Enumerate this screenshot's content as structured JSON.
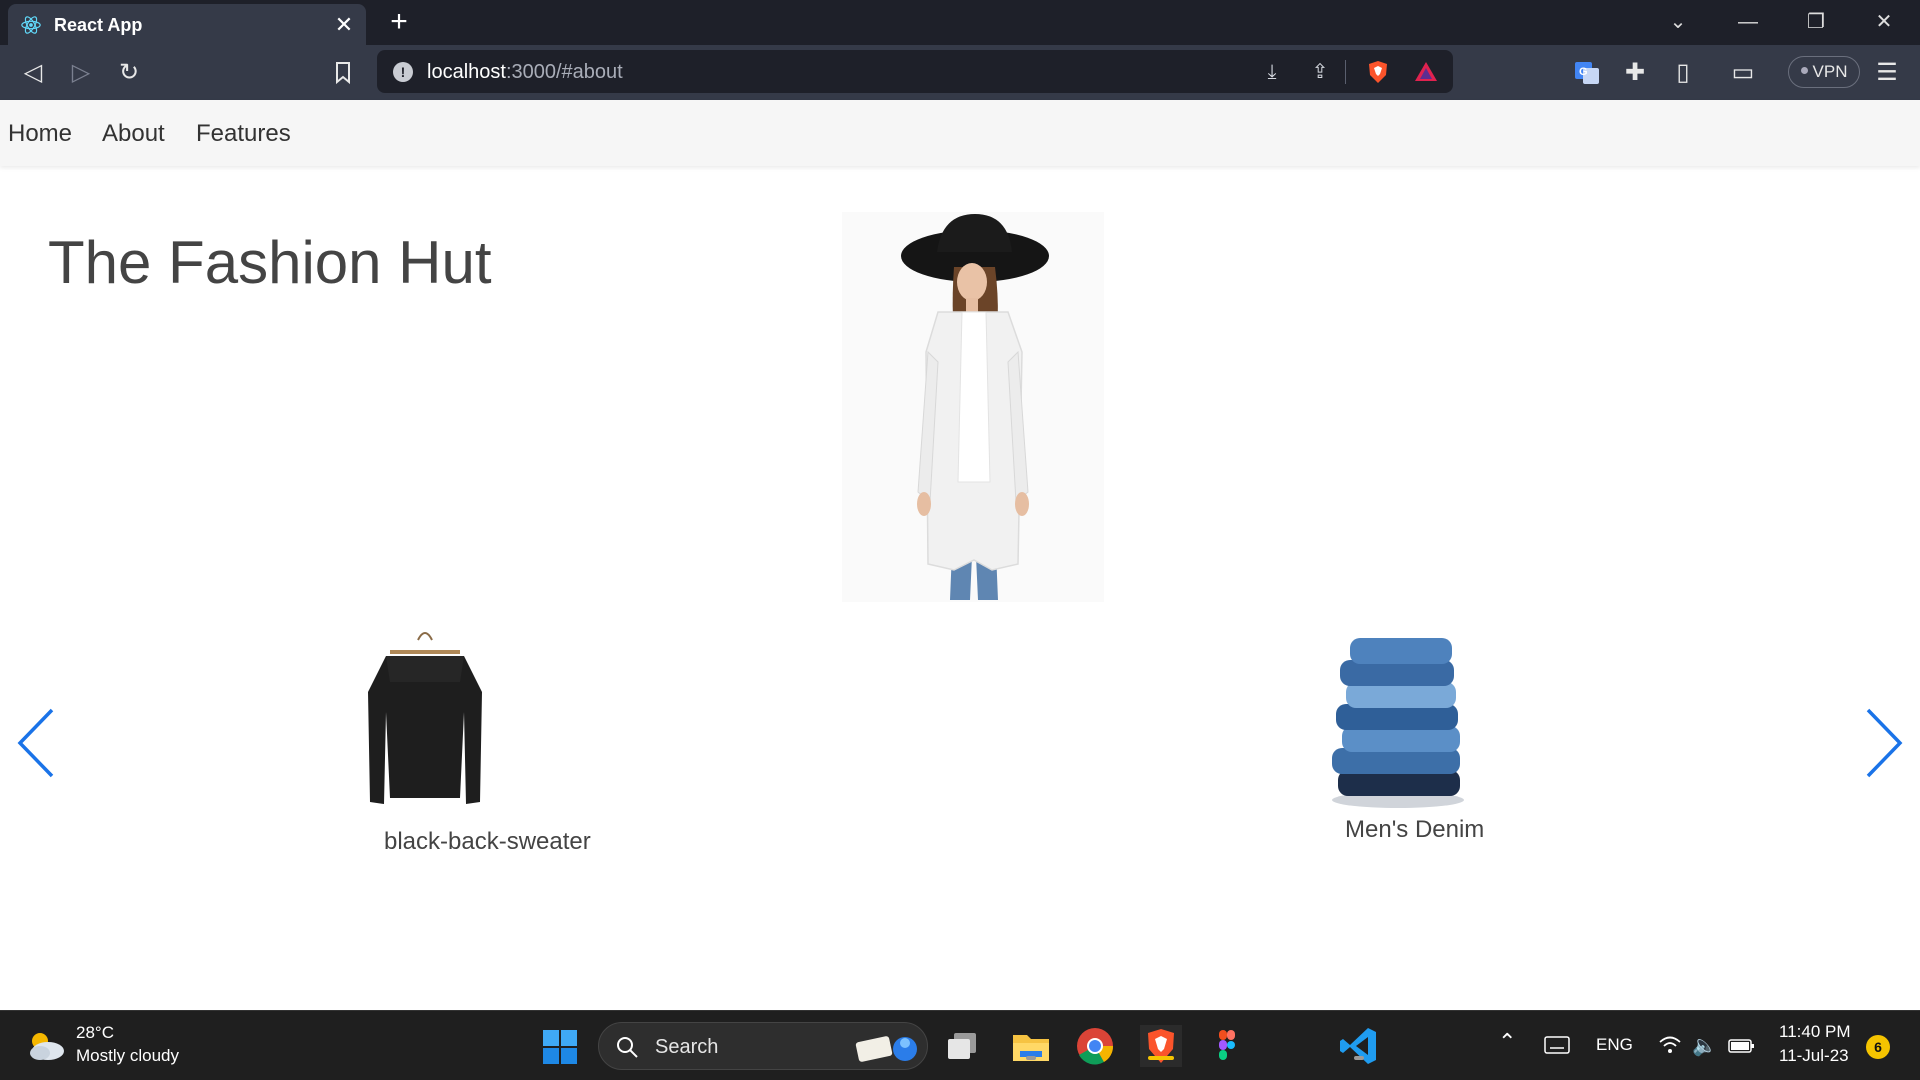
{
  "browser": {
    "tab_title": "React App",
    "url_host": "localhost",
    "url_rest": ":3000/#about",
    "vpn_label": "VPN"
  },
  "nav": {
    "items": [
      "Home",
      "About",
      "Features"
    ]
  },
  "page": {
    "title": "The Fashion Hut",
    "products": [
      {
        "caption": "black-back-sweater"
      },
      {
        "caption": "Men's Denim"
      }
    ]
  },
  "taskbar": {
    "weather_temp": "28°C",
    "weather_desc": "Mostly cloudy",
    "search_label": "Search",
    "lang": "ENG",
    "time": "11:40 PM",
    "date": "11-Jul-23",
    "notifications": "6"
  },
  "colors": {
    "carousel_arrow": "#1a73e8",
    "browser_tabbar": "#1e2029",
    "browser_toolbar": "#353a48",
    "taskbar": "#1f1f1f"
  }
}
